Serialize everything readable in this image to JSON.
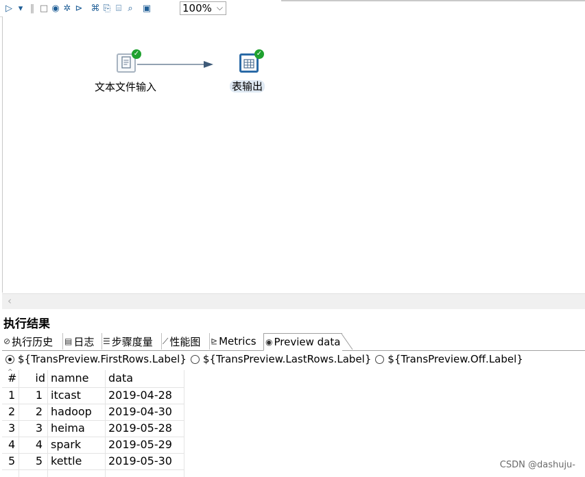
{
  "toolbar": {
    "icons": [
      "run-icon",
      "run-options-icon",
      "pause-icon",
      "stop-icon",
      "preview-icon",
      "debug-icon",
      "replay-icon",
      "verify-icon",
      "impact-icon",
      "sql-icon",
      "explore-db-icon",
      "show-results-icon"
    ],
    "zoom": "100%"
  },
  "canvas": {
    "steps": [
      {
        "label": "文本文件输入",
        "icon": "text-file-input-icon",
        "status": "success"
      },
      {
        "label": "表输出",
        "icon": "table-output-icon",
        "status": "success"
      }
    ]
  },
  "results": {
    "title": "执行结果",
    "tabs": [
      {
        "label": "执行历史",
        "icon": "history-icon"
      },
      {
        "label": "日志",
        "icon": "log-icon"
      },
      {
        "label": "步骤度量",
        "icon": "step-metrics-icon"
      },
      {
        "label": "性能图",
        "icon": "performance-chart-icon"
      },
      {
        "label": "Metrics",
        "icon": "metrics-icon"
      },
      {
        "label": "Preview data",
        "icon": "preview-eye-icon",
        "active": true
      }
    ],
    "radio_options": [
      {
        "label": "${TransPreview.FirstRows.Label}",
        "selected": true
      },
      {
        "label": "${TransPreview.LastRows.Label}",
        "selected": false
      },
      {
        "label": "${TransPreview.Off.Label}",
        "selected": false
      }
    ],
    "columns": [
      "#",
      "id",
      "namne",
      "data"
    ],
    "rows": [
      [
        "1",
        "1",
        "itcast",
        "2019-04-28"
      ],
      [
        "2",
        "2",
        "hadoop",
        "2019-04-30"
      ],
      [
        "3",
        "3",
        "heima",
        "2019-05-28"
      ],
      [
        "4",
        "4",
        "spark",
        "2019-05-29"
      ],
      [
        "5",
        "5",
        "kettle",
        "2019-05-30"
      ]
    ]
  },
  "watermark": "CSDN @dashuju-",
  "colors": {
    "accent": "#1f5e96",
    "success": "#1fa12f",
    "selection": "#dfe9f3"
  }
}
